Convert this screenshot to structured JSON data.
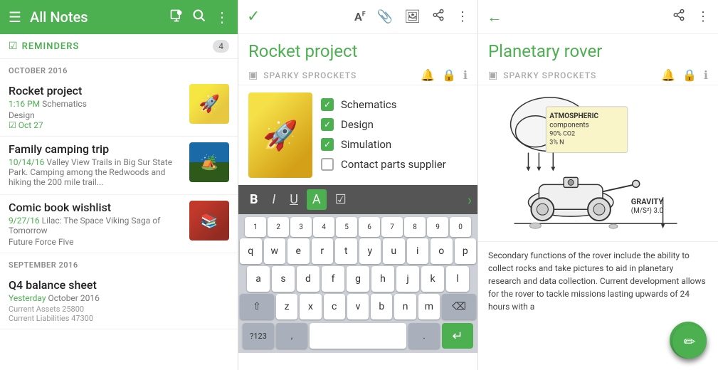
{
  "panel1": {
    "topbar": {
      "title": "All Notes",
      "menu_icon": "☰",
      "compose_icon": "✏",
      "search_icon": "🔍",
      "more_icon": "⋮"
    },
    "reminders": {
      "label": "REMINDERS",
      "badge": "4"
    },
    "section1": "OCTOBER 2016",
    "notes": [
      {
        "title": "Rocket project",
        "meta_date": "1:16 PM",
        "meta_tag": "Schematics",
        "sub": "Design",
        "extra": "☑ Oct 27",
        "thumb_type": "rocket"
      },
      {
        "title": "Family camping trip",
        "meta_date": "10/14/16",
        "meta_tag": "Valley View Trails in Big Sur State Park. Camping among the Redwoods and hiking the 200 mile trail...",
        "sub": "",
        "extra": "",
        "thumb_type": "camping"
      },
      {
        "title": "Comic book wishlist",
        "meta_date": "9/27/16",
        "meta_tag": "Lilac: The Space Viking Saga of Tomorrow",
        "sub": "Future Force Five",
        "extra": "",
        "thumb_type": "book"
      }
    ],
    "section2": "SEPTEMBER 2016",
    "notes2": [
      {
        "title": "Q4 balance sheet",
        "meta_date": "Yesterday",
        "meta_tag": "October 2016",
        "line1": "Current Assets      25800",
        "line2": "Current Liabilities  47300"
      }
    ],
    "fab_label": "+"
  },
  "panel2": {
    "topbar": {
      "check_icon": "✓",
      "format_icon": "A",
      "attach_icon": "📎",
      "image_icon": "🖼",
      "share_icon": "↗",
      "more_icon": "⋮"
    },
    "title": "Rocket project",
    "notebook": "SPARKY SPROCKETS",
    "checklist": [
      {
        "label": "Schematics",
        "checked": true
      },
      {
        "label": "Design",
        "checked": true
      },
      {
        "label": "Simulation",
        "checked": true
      },
      {
        "label": "Contact parts supplier",
        "checked": false
      }
    ],
    "format_toolbar": {
      "bold": "B",
      "italic": "I",
      "underline": "U",
      "highlight": "A",
      "task": "☑",
      "arrow": "›"
    },
    "keyboard": {
      "numbers": [
        "1",
        "2",
        "3",
        "4",
        "5",
        "6",
        "7",
        "8",
        "9",
        "0"
      ],
      "row1": [
        "q",
        "w",
        "e",
        "r",
        "t",
        "y",
        "u",
        "i",
        "o",
        "p"
      ],
      "row2": [
        "a",
        "s",
        "d",
        "f",
        "g",
        "h",
        "j",
        "k",
        "l"
      ],
      "row3": [
        "z",
        "x",
        "c",
        "v",
        "b",
        "n",
        "m"
      ],
      "sym_label": "?123",
      "del_label": "⌫",
      "shift_label": "⇧"
    }
  },
  "panel3": {
    "topbar": {
      "back_icon": "←",
      "share_icon": "↗",
      "more_icon": "⋮"
    },
    "title": "Planetary rover",
    "notebook": "SPARKY SPROCKETS",
    "sketch_desc": "Rover sketch with atmospheric components annotation",
    "body_text": "Secondary functions of the rover include the ability to collect rocks and take pictures to aid in planetary research and data collection. Current development allows for the rover to tackle missions lasting upwards of 24 hours with a",
    "fab_icon": "✏"
  }
}
